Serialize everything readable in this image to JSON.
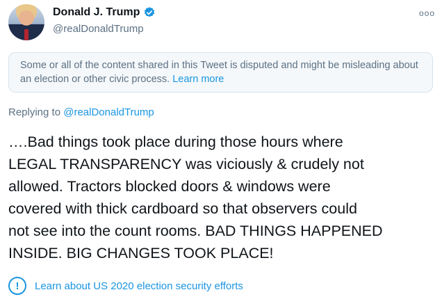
{
  "author": {
    "name": "Donald J. Trump",
    "handle": "@realDonaldTrump",
    "avatar_icon": "profile-photo",
    "verified_icon": "verified-badge-icon"
  },
  "more_icon": "more-options-icon",
  "more_label": "ooo",
  "notice": {
    "text": "Some or all of the content shared in this Tweet is disputed and might be misleading about an election or other civic process. ",
    "link": "Learn more"
  },
  "reply": {
    "prefix": "Replying to ",
    "handle": "@realDonaldTrump"
  },
  "tweet_text": "….Bad things took place during those hours where\nLEGAL TRANSPARENCY was viciously & crudely not\nallowed. Tractors blocked doors & windows were\ncovered with thick cardboard so that observers could\nnot see into the count rooms. BAD THINGS HAPPENED\nINSIDE. BIG CHANGES TOOK PLACE!",
  "election_link": {
    "icon": "info-circle-icon",
    "icon_glyph": "!",
    "label": "Learn about US 2020 election security efforts"
  },
  "colors": {
    "link": "#1b95e0",
    "muted": "#5b7083",
    "notice_bg": "#f5f8fa"
  }
}
